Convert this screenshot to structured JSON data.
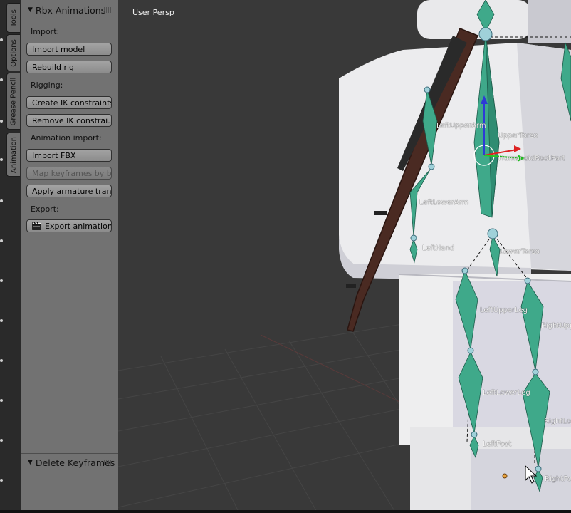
{
  "tabs": [
    "Tools",
    "Options",
    "Grease Pencil",
    "Animation"
  ],
  "panel": {
    "title": "Rbx Animations",
    "import_label": "Import:",
    "import_model": "Import model",
    "rebuild_rig": "Rebuild rig",
    "rigging_label": "Rigging:",
    "create_ik": "Create IK constraints",
    "remove_ik": "Remove IK constrai...",
    "anim_import_label": "Animation import:",
    "import_fbx": "Import FBX",
    "map_keyframes": "Map keyframes by b...",
    "apply_armature": "Apply armature tran...",
    "export_label": "Export:",
    "export_animation": "Export animation"
  },
  "delete_panel": {
    "title": "Delete Keyframes"
  },
  "viewport": {
    "view_name": "User Persp",
    "bones": {
      "left_upper_arm": "LeftUpperArm",
      "upper_torso": "UpperTorso",
      "humanoid_root": "HumanoidRootPart",
      "left_lower_arm": "LeftLowerArm",
      "left_hand": "LeftHand",
      "lower_torso": "LowerTorso",
      "left_upper_leg": "LeftUpperLeg",
      "right_upper_leg": "RightUpp",
      "left_lower_leg": "LeftLowerLeg",
      "right_lower_leg": "RightLow",
      "left_foot": "LeftFoot",
      "right_foot": "RightFo"
    }
  },
  "colors": {
    "bone_fill": "#3fa98a",
    "bone_highlight": "#6fd2b2",
    "body_light": "#e8e8ea",
    "viewport_bg": "#393939",
    "panel_bg": "#727272"
  }
}
